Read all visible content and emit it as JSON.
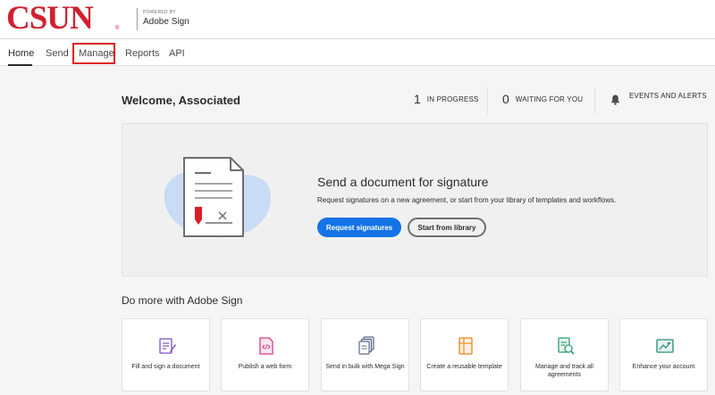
{
  "brand": {
    "logo": "CSUN",
    "reg_mark": "®",
    "powered_by": "POWERED BY",
    "product": "Adobe Sign",
    "logo_color": "#d22030"
  },
  "nav": {
    "items": [
      {
        "label": "Home",
        "active": true
      },
      {
        "label": "Send",
        "active": false
      },
      {
        "label": "Manage",
        "active": false,
        "highlighted": true
      },
      {
        "label": "Reports",
        "active": false
      },
      {
        "label": "API",
        "active": false
      }
    ]
  },
  "welcome": {
    "title": "Welcome, Associated"
  },
  "stats": {
    "in_progress": {
      "count": "1",
      "label": "IN PROGRESS"
    },
    "waiting": {
      "count": "0",
      "label": "WAITING FOR YOU"
    },
    "events": {
      "label": "EVENTS AND ALERTS",
      "icon": "bell-icon"
    }
  },
  "hero": {
    "title": "Send a document for signature",
    "subtitle": "Request signatures on a new agreement, or start from your library of templates and workflows.",
    "primary_button": "Request signatures",
    "secondary_button": "Start from library",
    "accent_color": "#1473e6"
  },
  "more": {
    "heading": "Do more with Adobe Sign",
    "cards": [
      {
        "label": "Fill and sign a document",
        "icon": "fill-sign-icon"
      },
      {
        "label": "Publish a web form",
        "icon": "web-form-icon"
      },
      {
        "label": "Send in bulk with Mega Sign",
        "icon": "mega-sign-icon"
      },
      {
        "label": "Create a reusable template",
        "icon": "template-icon"
      },
      {
        "label": "Manage and track all agreements",
        "icon": "manage-track-icon"
      },
      {
        "label": "Enhance your account",
        "icon": "enhance-account-icon"
      }
    ]
  }
}
